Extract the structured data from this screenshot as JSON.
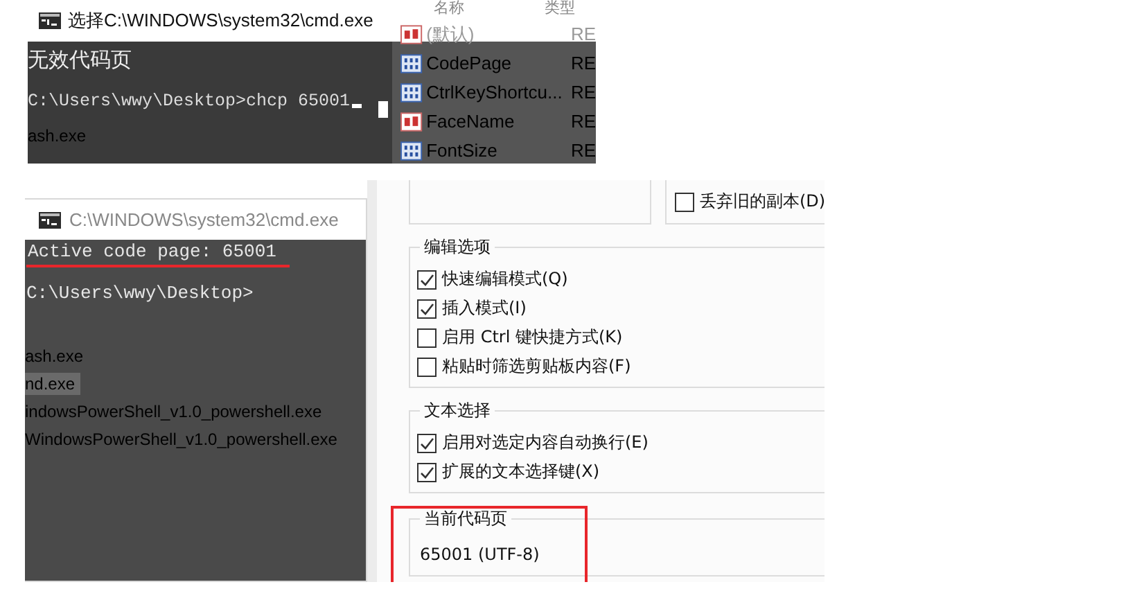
{
  "top_window": {
    "title": "选择C:\\WINDOWS\\system32\\cmd.exe",
    "lines": [
      {
        "kind": "message",
        "text": "无效代码页"
      },
      {
        "kind": "prompt",
        "text": "C:\\Users\\wwy\\Desktop>chcp 65001"
      }
    ],
    "file_list": [
      "ash.exe"
    ],
    "registry_columns": [
      "名称",
      "类型"
    ],
    "registry_values": [
      {
        "kind": "string",
        "name": "(默认)",
        "type": "RE"
      },
      {
        "kind": "binary",
        "name": "CodePage",
        "type": "RE"
      },
      {
        "kind": "binary",
        "name": "CtrlKeyShortcu...",
        "type": "RE"
      },
      {
        "kind": "string",
        "name": "FaceName",
        "type": "RE"
      },
      {
        "kind": "binary",
        "name": "FontSize",
        "type": "RE"
      }
    ]
  },
  "bottom_window": {
    "title": "C:\\WINDOWS\\system32\\cmd.exe",
    "lines": [
      {
        "text": "Active code page: 65001",
        "underlined": true
      },
      {
        "text": "C:\\Users\\wwy\\Desktop>",
        "underlined": false
      }
    ],
    "file_list": [
      {
        "name": "ash.exe",
        "selected": false
      },
      {
        "name": "nd.exe",
        "selected": true
      },
      {
        "name": "indowsPowerShell_v1.0_powershell.exe",
        "selected": false
      },
      {
        "name": "WindowsPowerShell_v1.0_powershell.exe",
        "selected": false
      }
    ]
  },
  "options": {
    "discard_old_copies": {
      "label": "丢弃旧的副本(D)",
      "checked": false
    },
    "groups": [
      {
        "title": "编辑选项",
        "options": [
          {
            "label": "快速编辑模式(Q)",
            "checked": true
          },
          {
            "label": "插入模式(I)",
            "checked": true
          },
          {
            "label": "启用 Ctrl 键快捷方式(K)",
            "checked": false
          },
          {
            "label": "粘贴时筛选剪贴板内容(F)",
            "checked": false
          }
        ]
      },
      {
        "title": "文本选择",
        "options": [
          {
            "label": "启用对选定内容自动换行(E)",
            "checked": true
          },
          {
            "label": "扩展的文本选择键(X)",
            "checked": true
          }
        ]
      }
    ],
    "code_page": {
      "title": "当前代码页",
      "value": "65001 (UTF-8)",
      "highlighted": true
    }
  }
}
